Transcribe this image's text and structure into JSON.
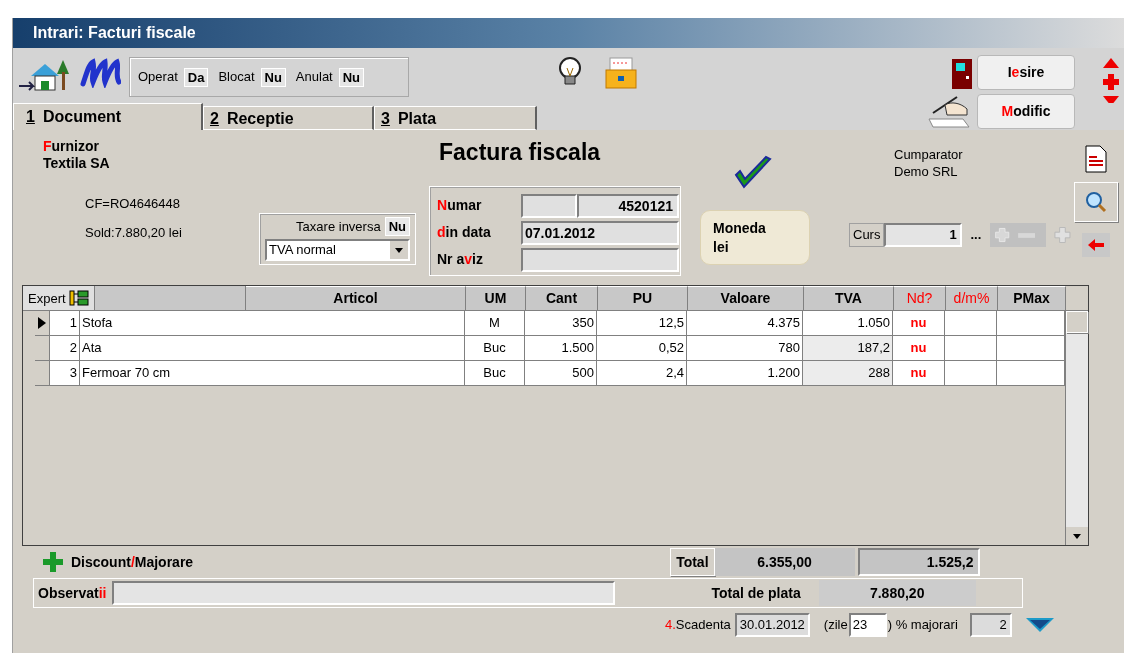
{
  "window": {
    "title": "Intrari: Facturi fiscale"
  },
  "status": [
    {
      "label": "Operat",
      "value": "Da"
    },
    {
      "label": "Blocat",
      "value": "Nu"
    },
    {
      "label": "Anulat",
      "value": "Nu"
    }
  ],
  "buttons": [
    {
      "kind": "exit",
      "label": [
        {
          "text": "I",
          "accent": false
        },
        {
          "text": "e",
          "accent": true
        },
        {
          "text": "sire",
          "accent": false
        }
      ]
    },
    {
      "kind": "edit",
      "label": [
        {
          "text": "M",
          "accent": true
        },
        {
          "text": "odific",
          "accent": false
        }
      ]
    }
  ],
  "tabs": [
    {
      "key": "1",
      "label": "Document",
      "selected": true
    },
    {
      "key": "2",
      "label": "Receptie",
      "selected": false
    },
    {
      "key": "3",
      "label": "Plata",
      "selected": false
    }
  ],
  "supplier": {
    "label": [
      {
        "text": "F",
        "accent": true
      },
      {
        "text": "urnizor",
        "accent": false
      }
    ],
    "name": "Textila SA",
    "tax_id": "CF=RO4646448",
    "balance": "Sold:7.880,20 lei"
  },
  "reverse_charge": {
    "label": "Taxare inversa",
    "value": "Nu",
    "vat_type": "TVA normal"
  },
  "document": {
    "title": "Factura fiscala",
    "fields": [
      {
        "kind": "split",
        "label": [
          {
            "text": "N",
            "accent": true
          },
          {
            "text": "umar",
            "accent": false
          }
        ],
        "value": "4520121"
      },
      {
        "kind": "wide",
        "label": [
          {
            "text": "d",
            "accent": true
          },
          {
            "text": "in data",
            "accent": false
          }
        ],
        "value": "07.01.2012"
      },
      {
        "kind": "wide",
        "label": [
          {
            "text": "Nr a",
            "accent": false
          },
          {
            "text": "v",
            "accent": true
          },
          {
            "text": "iz",
            "accent": false
          }
        ]
      }
    ]
  },
  "currency": {
    "label": "Moneda",
    "value": "lei"
  },
  "buyer": {
    "label": "Cumparator",
    "name": "Demo SRL"
  },
  "rate": {
    "label": "Curs",
    "value": "1",
    "more": "..."
  },
  "grid": {
    "columns": [
      {
        "kind": "expert",
        "label": "Expert",
        "accent": false
      },
      {
        "kind": "text",
        "label": "Articol",
        "accent": false
      },
      {
        "kind": "text",
        "label": "UM",
        "accent": false
      },
      {
        "kind": "text",
        "label": "Cant",
        "accent": false
      },
      {
        "kind": "text",
        "label": "PU",
        "accent": false
      },
      {
        "kind": "text",
        "label": "Valoare",
        "accent": false
      },
      {
        "kind": "text",
        "label": "TVA",
        "accent": false
      },
      {
        "kind": "text",
        "label": "Nd?",
        "accent": true
      },
      {
        "kind": "text",
        "label": "d/m%",
        "accent": true
      },
      {
        "kind": "text",
        "label": "PMax",
        "accent": false
      }
    ],
    "rows": [
      {
        "nr": "1",
        "article": "Stofa",
        "um": "M",
        "cant": "350",
        "pu": "12,5",
        "valoare": "4.375",
        "tva": "1.050",
        "nd": "nu",
        "selected": true
      },
      {
        "nr": "2",
        "article": "Ata",
        "um": "Buc",
        "cant": "1.500",
        "pu": "0,52",
        "valoare": "780",
        "tva": "187,2",
        "nd": "nu",
        "selected": false
      },
      {
        "nr": "3",
        "article": "Fermoar 70 cm",
        "um": "Buc",
        "cant": "500",
        "pu": "2,4",
        "valoare": "1.200",
        "tva": "288",
        "nd": "nu",
        "selected": false
      }
    ]
  },
  "totals": {
    "discount": [
      {
        "text": "Discount",
        "accent": false
      },
      {
        "text": "/",
        "accent": true
      },
      {
        "text": "Majorare",
        "accent": false
      }
    ],
    "total_label": "Total",
    "total_value": "6.355,00",
    "total_vat": "1.525,2",
    "notes_label": [
      {
        "text": "Observat",
        "accent": false
      },
      {
        "text": "ii",
        "accent": true
      }
    ],
    "grand_label": "Total de plata",
    "grand_value": "7.880,20"
  },
  "due": {
    "label": [
      {
        "text": "4.",
        "accent": true
      },
      {
        "text": "Scadenta",
        "accent": false
      }
    ],
    "date": "30.01.2012",
    "days_label": "(zile",
    "days": "23",
    "surcharge_label": ") % majorari",
    "surcharge": "2"
  }
}
